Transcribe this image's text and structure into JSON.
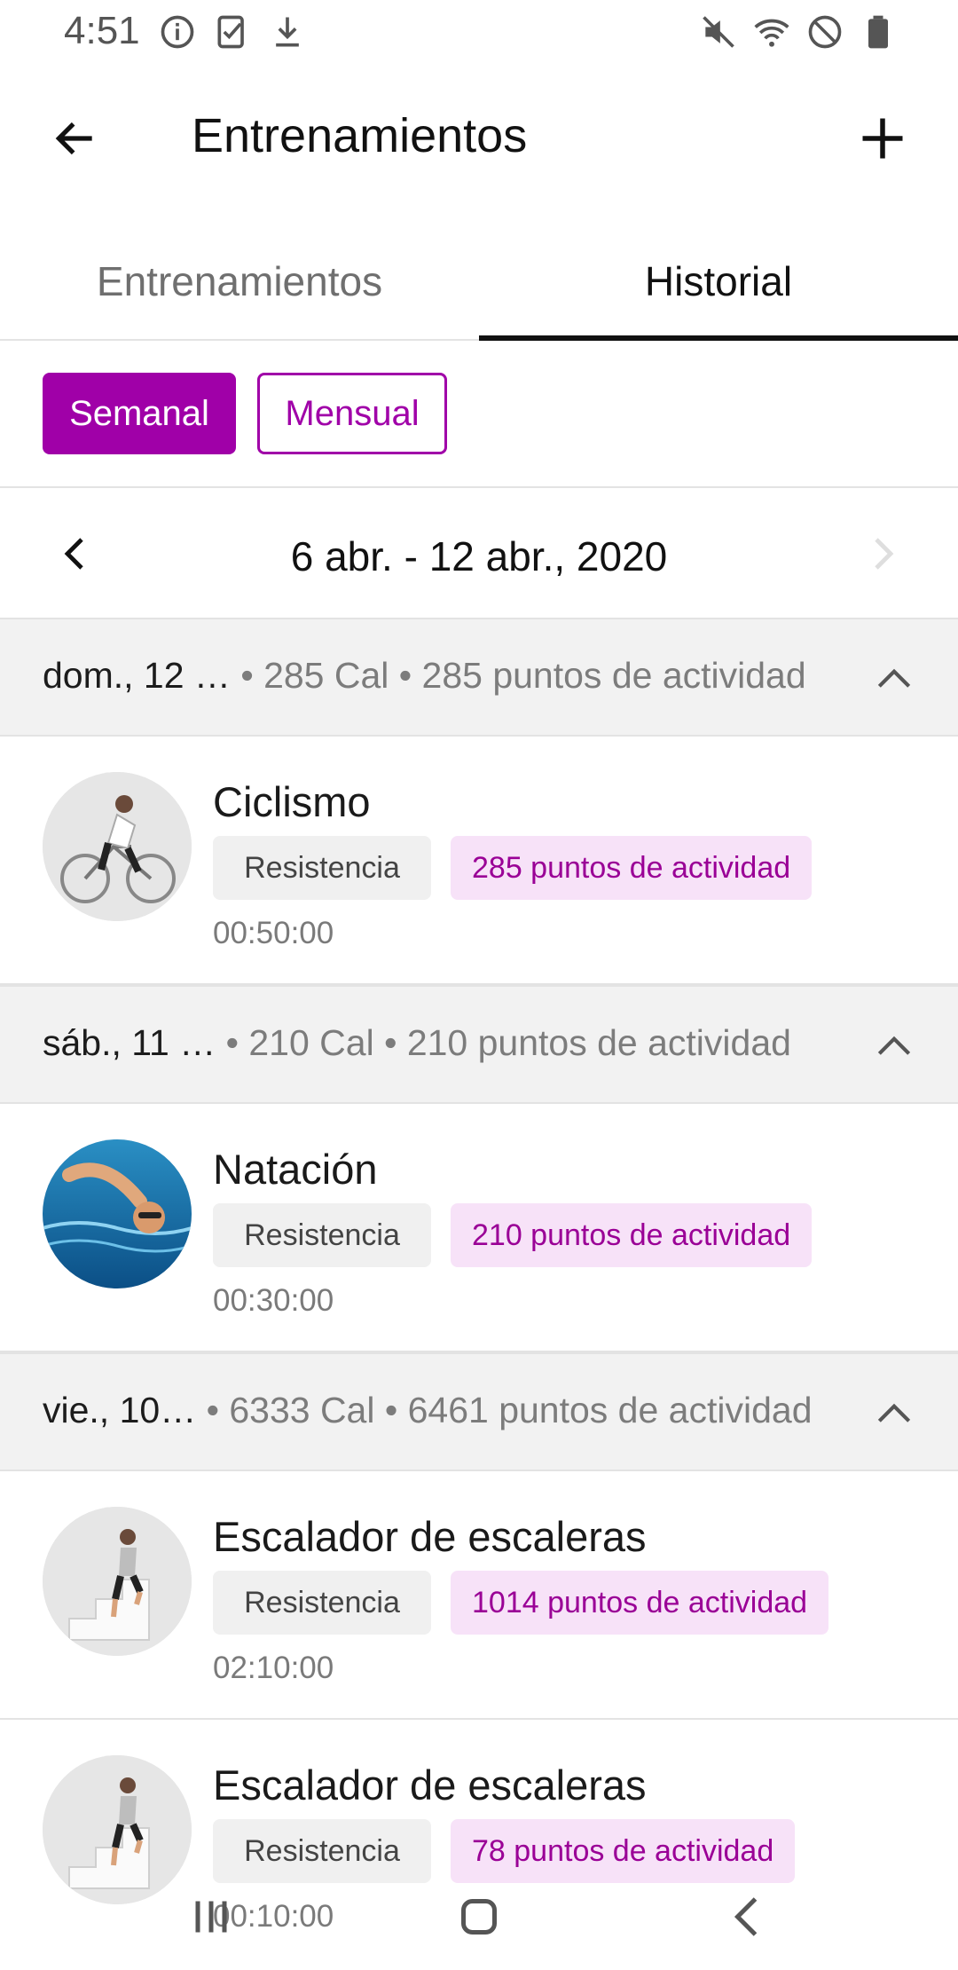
{
  "status_bar": {
    "time": "4:51",
    "left_icons": [
      "info-icon",
      "task-check-icon",
      "download-icon"
    ],
    "right_icons": [
      "mute-icon",
      "wifi-icon",
      "do-not-disturb-icon",
      "battery-icon"
    ]
  },
  "app_bar": {
    "title": "Entrenamientos",
    "back_icon": "arrow-back-icon",
    "add_icon": "plus-icon"
  },
  "tabs": [
    {
      "label": "Entrenamientos",
      "selected": false
    },
    {
      "label": "Historial",
      "selected": true
    }
  ],
  "period_toggle": {
    "weekly": "Semanal",
    "monthly": "Mensual",
    "selected": "weekly"
  },
  "date_nav": {
    "range": "6 abr. - 12 abr., 2020"
  },
  "colors": {
    "accent": "#a000a8",
    "chip_points_bg": "#f7e2f8",
    "chip_type_bg": "#f0f0f0",
    "header_bg": "#f2f2f2"
  },
  "days": [
    {
      "name": "dom., 12 …",
      "stats": " • 285 Cal • 285 puntos de actividad",
      "workouts": [
        {
          "title": "Ciclismo",
          "type": "Resistencia",
          "points": "285 puntos de actividad",
          "duration": "00:50:00",
          "image": "cycling-image"
        }
      ]
    },
    {
      "name": "sáb., 11 …",
      "stats": " • 210 Cal • 210 puntos de actividad",
      "workouts": [
        {
          "title": "Natación",
          "type": "Resistencia",
          "points": "210 puntos de actividad",
          "duration": "00:30:00",
          "image": "swimming-image"
        }
      ]
    },
    {
      "name": "vie., 10…",
      "stats": " • 6333 Cal • 6461 puntos de actividad",
      "workouts": [
        {
          "title": "Escalador de escaleras",
          "type": "Resistencia",
          "points": "1014 puntos de actividad",
          "duration": "02:10:00",
          "image": "stair-climber-image"
        },
        {
          "title": "Escalador de escaleras",
          "type": "Resistencia",
          "points": "78 puntos de actividad",
          "duration": "00:10:00",
          "image": "stair-climber-image"
        }
      ]
    }
  ],
  "nav_bar": {
    "icons": [
      "recent-apps-icon",
      "home-icon",
      "back-icon"
    ]
  }
}
